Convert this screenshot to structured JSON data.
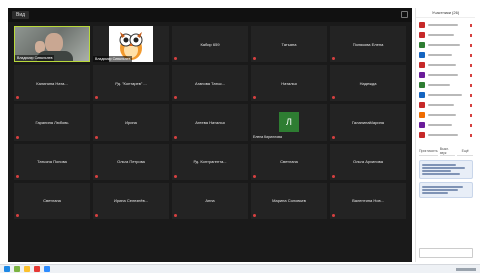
{
  "toolbar": {
    "view_label": "Вид"
  },
  "tiles": [
    {
      "name": "Владимир Сивальнев",
      "type": "video"
    },
    {
      "name": "Владимир Сивальнев",
      "type": "owl"
    },
    {
      "name": "Кабир 659"
    },
    {
      "name": "Татьяна"
    },
    {
      "name": "Полякова Елена"
    },
    {
      "name": "Калинина Ната..."
    },
    {
      "name": "Рд. \"Контарев\" ..."
    },
    {
      "name": "Агапова Татья..."
    },
    {
      "name": "Наталья"
    },
    {
      "name": "Надежда"
    },
    {
      "name": "Гаранина Любовь"
    },
    {
      "name": "Ирина"
    },
    {
      "name": "Агеева Наталья"
    },
    {
      "name": "Л",
      "type": "initial",
      "caption": "Елена Кириллова"
    },
    {
      "name": "ГаланинаМарина"
    },
    {
      "name": "Татьяна Попова"
    },
    {
      "name": "Ольга Петрова"
    },
    {
      "name": "Рд. Контрагента..."
    },
    {
      "name": "Светлана"
    },
    {
      "name": "Ольга Архипова"
    },
    {
      "name": "Светлана"
    },
    {
      "name": "Ирина Селезнёв..."
    },
    {
      "name": "Анна"
    },
    {
      "name": "Марина Соловьев"
    },
    {
      "name": "Валентина Нов..."
    }
  ],
  "panel": {
    "title": "Участники (26)",
    "participants_colors": [
      "#c62828",
      "#c62828",
      "#2e7d32",
      "#1565c0",
      "#c62828",
      "#6a1b9a",
      "#2e7d32",
      "#1565c0",
      "#c62828",
      "#ef6c00",
      "#6a1b9a",
      "#c62828"
    ],
    "tabs": [
      "Пригласить",
      "Выкл. звук",
      "Ещё"
    ]
  }
}
